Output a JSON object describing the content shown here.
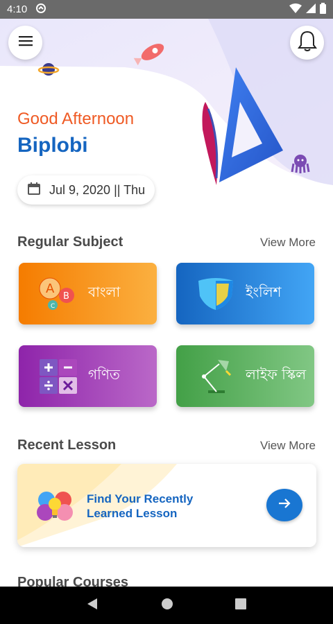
{
  "status_bar": {
    "time": "4:10"
  },
  "header": {
    "greeting": "Good Afternoon",
    "username": "Biplobi",
    "date": "Jul 9, 2020 || Thu"
  },
  "regular_subject": {
    "title": "Regular Subject",
    "view_more": "View More",
    "subjects": [
      {
        "label": "বাংলা"
      },
      {
        "label": "ইংলিশ"
      },
      {
        "label": "গণিত"
      },
      {
        "label": "লাইফ স্কিল"
      }
    ]
  },
  "recent_lesson": {
    "title": "Recent Lesson",
    "view_more": "View More",
    "card_line1": "Find Your Recently",
    "card_line2": "Learned Lesson"
  },
  "popular_courses": {
    "title": "Popular Courses"
  },
  "colors": {
    "accent_orange": "#ef5a24",
    "brand_blue": "#1565c0",
    "bangla_card": "#f7931e",
    "english_card": "#1e6fd0",
    "math_card": "#9c3fb8",
    "lifeskill_card": "#46a84a"
  },
  "icons": [
    "menu-icon",
    "bell-icon",
    "calendar-icon",
    "arrow-right-icon",
    "back-icon",
    "home-icon",
    "recents-icon"
  ]
}
